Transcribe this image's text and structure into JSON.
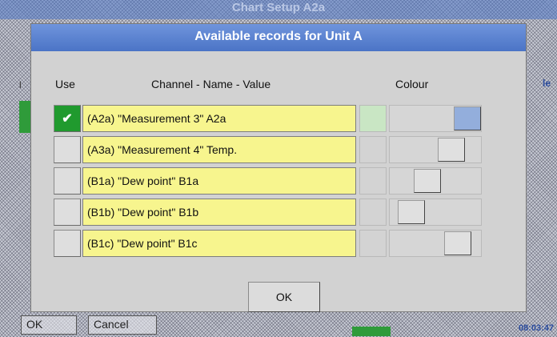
{
  "background": {
    "window_title": "Chart Setup A2a",
    "left_button": "OK",
    "cancel_button": "Cancel",
    "clock": "08:03:47",
    "side_label_right": "le",
    "side_label_left": "l"
  },
  "dialog": {
    "title": "Available records for Unit A",
    "headers": {
      "use": "Use",
      "channel": "Channel - Name - Value",
      "colour": "Colour"
    },
    "rows": [
      {
        "name": "(A2a) \"Measurement 3\" A2a",
        "checked": true,
        "check_mark": "✔",
        "swatch_color": "#c9e6c4",
        "thumb_color": "#93aedc",
        "slider_level": 1.0
      },
      {
        "name": "(A3a) \"Measurement 4\" Temp.",
        "checked": false,
        "check_mark": "",
        "swatch_color": "#d3d3d3",
        "thumb_color": "#e0e0e0",
        "slider_level": 0.75
      },
      {
        "name": "(B1a) \"Dew point\" B1a",
        "checked": false,
        "check_mark": "",
        "swatch_color": "#d3d3d3",
        "thumb_color": "#e0e0e0",
        "slider_level": 0.38
      },
      {
        "name": "(B1b) \"Dew point\" B1b",
        "checked": false,
        "check_mark": "",
        "swatch_color": "#d3d3d3",
        "thumb_color": "#e0e0e0",
        "slider_level": 0.12
      },
      {
        "name": "(B1c) \"Dew point\" B1c",
        "checked": false,
        "check_mark": "",
        "swatch_color": "#d3d3d3",
        "thumb_color": "#e0e0e0",
        "slider_level": 0.85
      }
    ],
    "ok_label": "OK"
  }
}
